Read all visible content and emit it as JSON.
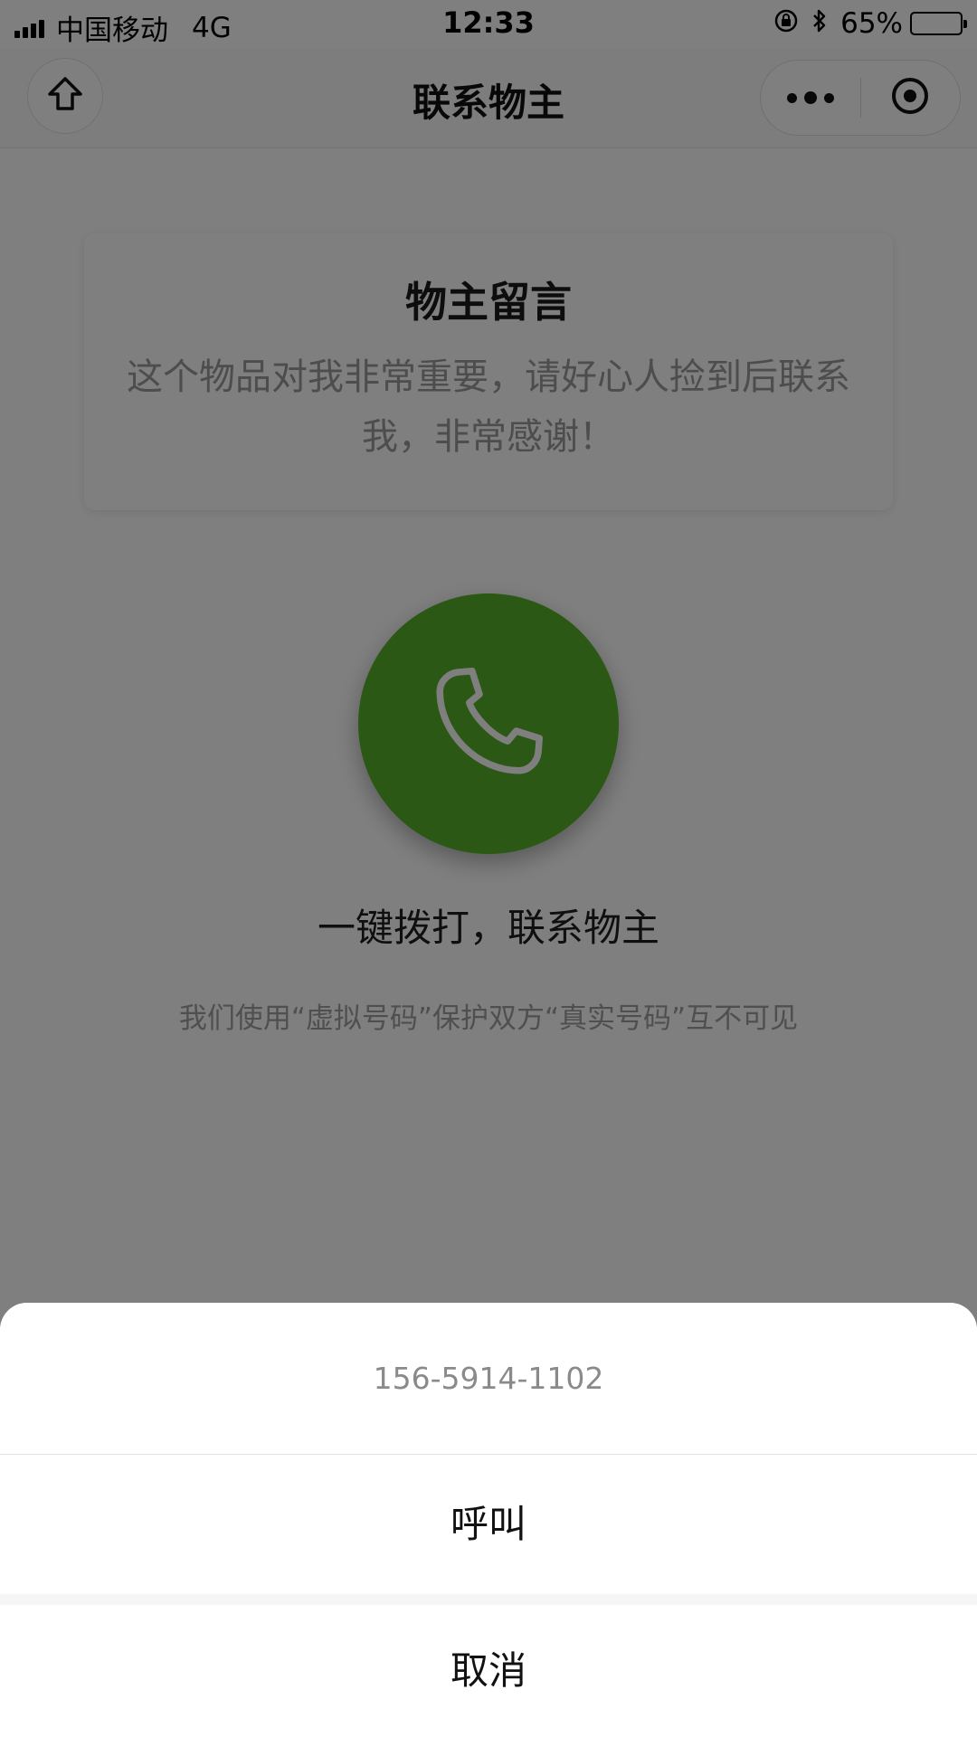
{
  "status_bar": {
    "carrier": "中国移动",
    "network": "4G",
    "time": "12:33",
    "battery": "65%",
    "battery_level": 0.65
  },
  "nav": {
    "title": "联系物主"
  },
  "message_card": {
    "title": "物主留言",
    "body": "这个物品对我非常重要，请好心人捡到后联系我，非常感谢！"
  },
  "call": {
    "accent_color": "#58b02a",
    "label": "一键拨打，联系物主",
    "privacy_note": "我们使用“虚拟号码”保护双方“真实号码”互不可见"
  },
  "action_sheet": {
    "phone_number": "156-5914-1102",
    "call_label": "呼叫",
    "cancel_label": "取消"
  }
}
